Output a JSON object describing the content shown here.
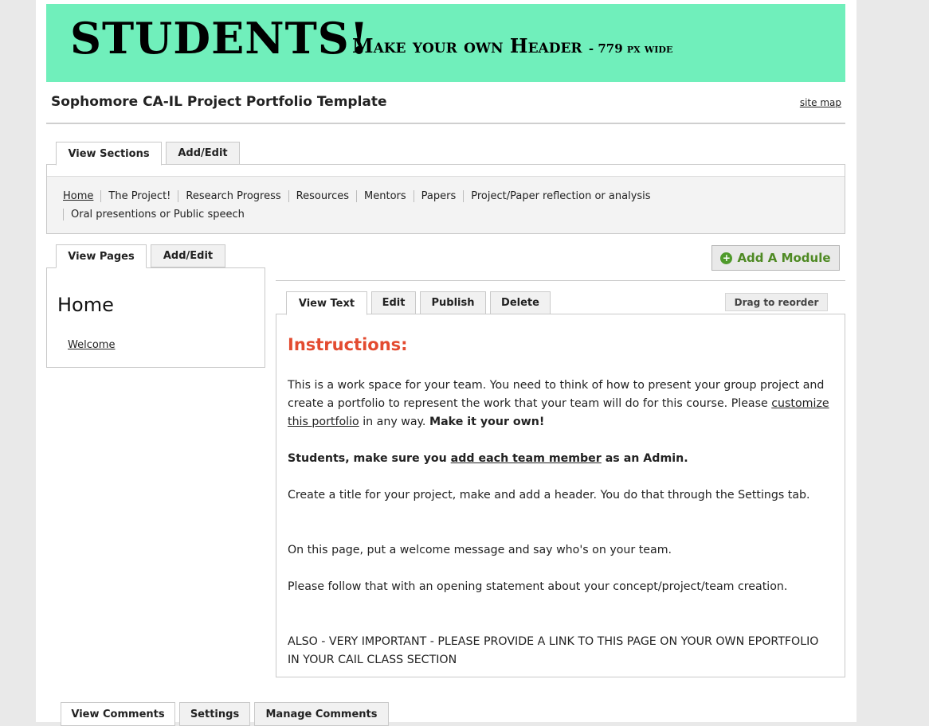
{
  "header": {
    "big_text": "STUDENTS!",
    "small_text": "Make your own Header",
    "small_suffix": "- 779 px wide"
  },
  "site_title": "Sophomore CA-IL Project Portfolio Template",
  "sitemap_label": "site map",
  "section_tabs": [
    "View Sections",
    "Add/Edit"
  ],
  "sections_nav": {
    "line1": [
      "Home",
      "The Project!",
      "Research Progress",
      "Resources",
      "Mentors",
      "Papers",
      "Project/Paper reflection or analysis"
    ],
    "line2": [
      "Oral presentions or Public speech"
    ]
  },
  "page_tabs": [
    "View Pages",
    "Add/Edit"
  ],
  "pages_panel": {
    "heading": "Home",
    "link": "Welcome"
  },
  "add_module_label": "Add A Module",
  "module_tabs": [
    "View Text",
    "Edit",
    "Publish",
    "Delete"
  ],
  "drag_label": "Drag to reorder",
  "content": {
    "heading": "Instructions:",
    "p1_a": "This is a work space for your team. You need to think of how to present your group project and create a portfolio to represent the work that your team will do for this course. Please ",
    "p1_link": "customize this portfolio",
    "p1_b": " in any way. ",
    "p1_bold": "Make it your own!",
    "p2_a": "Students, make sure you ",
    "p2_link": "add each team member",
    "p2_b": " as an Admin.",
    "p3": "Create a title for your project, make and add a header. You do that through the Settings tab.",
    "p4": "On this page, put a welcome message and say who's on your team.",
    "p5": "Please follow that with an opening statement about your concept/project/team creation.",
    "p6": "ALSO - VERY IMPORTANT - PLEASE PROVIDE A LINK TO THIS PAGE ON YOUR OWN EPORTFOLIO IN YOUR CAIL CLASS SECTION"
  },
  "comment_tabs": [
    "View Comments",
    "Settings",
    "Manage Comments"
  ]
}
